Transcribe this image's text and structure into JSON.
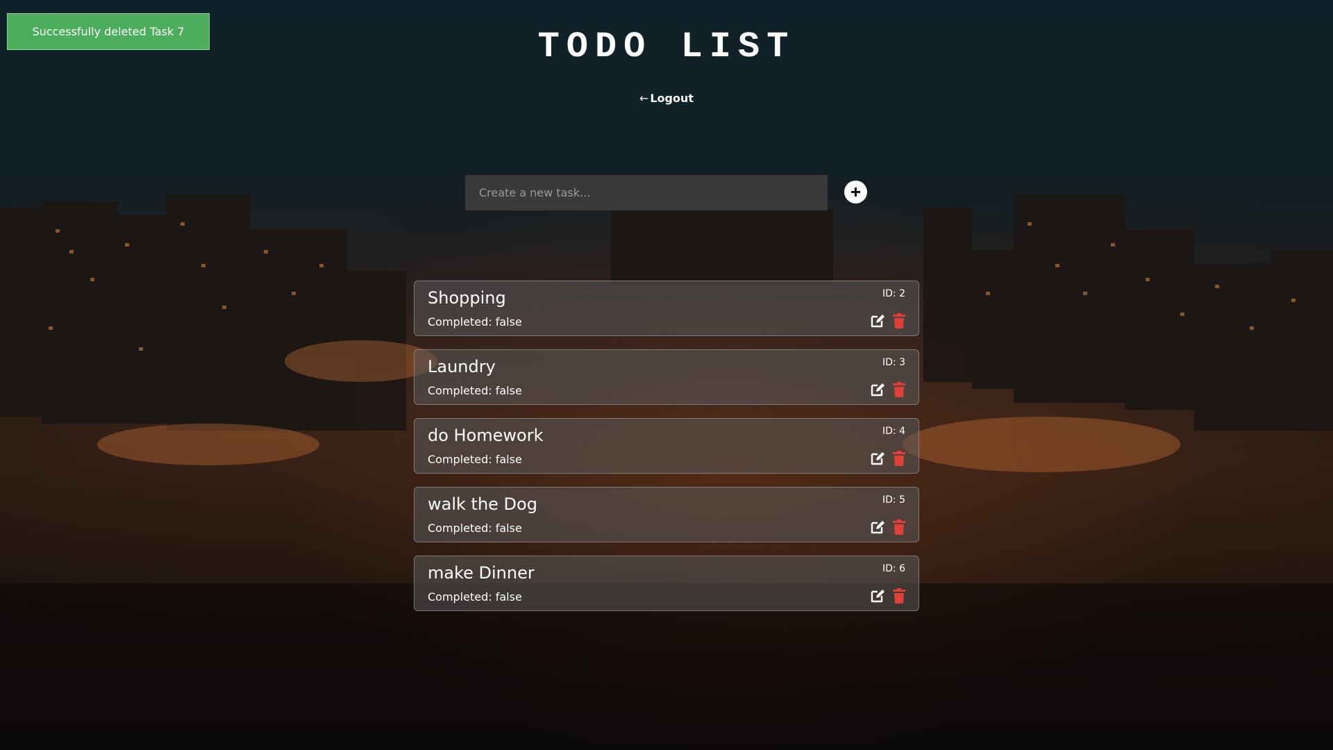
{
  "toast": {
    "message": "Successfully deleted Task 7",
    "color": "#4cae5c"
  },
  "header": {
    "title": "TODO LIST",
    "logout_arrow": "←",
    "logout_label": "Logout"
  },
  "new_task": {
    "placeholder": "Create a new task...",
    "value": "",
    "add_icon": "plus-icon"
  },
  "tasks": [
    {
      "title": "Shopping",
      "status": "Completed: false",
      "id": "ID: 2"
    },
    {
      "title": "Laundry",
      "status": "Completed: false",
      "id": "ID: 3"
    },
    {
      "title": "do Homework",
      "status": "Completed: false",
      "id": "ID: 4"
    },
    {
      "title": "walk the Dog",
      "status": "Completed: false",
      "id": "ID: 5"
    },
    {
      "title": "make Dinner",
      "status": "Completed: false",
      "id": "ID: 6"
    }
  ],
  "icons": {
    "edit": "edit-icon",
    "delete": "trash-icon"
  },
  "colors": {
    "delete_icon": "#e0403a",
    "edit_icon": "#ffffff",
    "card_background": "#5a5a5a"
  }
}
